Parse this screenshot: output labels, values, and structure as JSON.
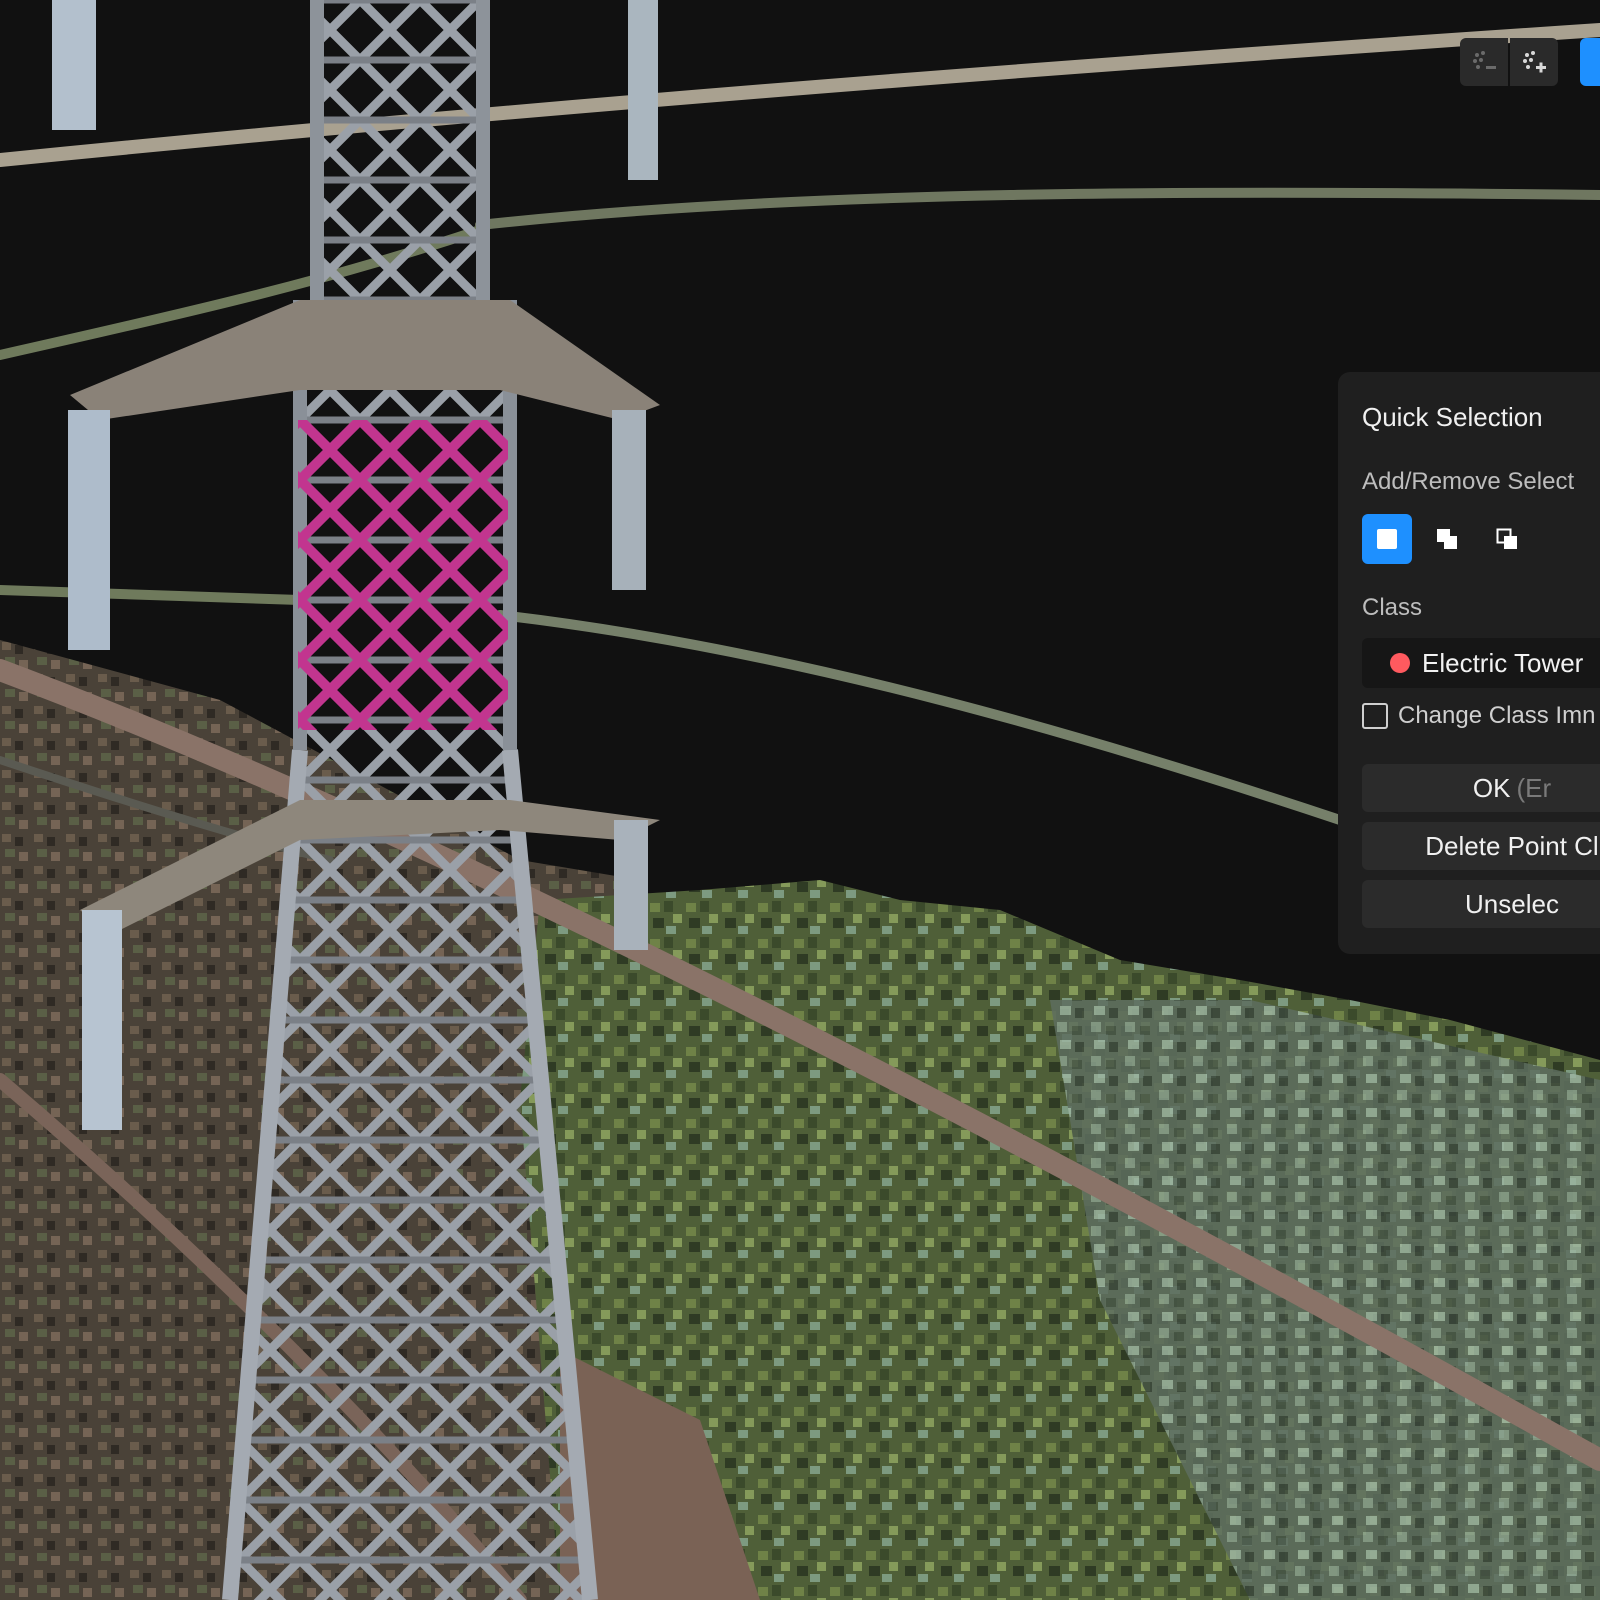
{
  "toolbar": {
    "icons": [
      "point-cloud-remove-icon",
      "point-cloud-add-icon"
    ],
    "active_color": "#1e90ff"
  },
  "panel": {
    "title": "Quick Selection",
    "add_remove_label": "Add/Remove Select",
    "modes": [
      "replace-selection-icon",
      "add-selection-icon",
      "remove-selection-icon"
    ],
    "active_mode": 0,
    "class_label": "Class",
    "class_value": "Electric Tower",
    "class_color": "#ff5a5f",
    "change_class_label": "Change Class Imn",
    "change_class_checked": false,
    "ok_label": "OK",
    "ok_hint": "(Er",
    "delete_label": "Delete Point Cl",
    "unselect_label": "Unselec"
  },
  "highlight_color": "#c2358f"
}
